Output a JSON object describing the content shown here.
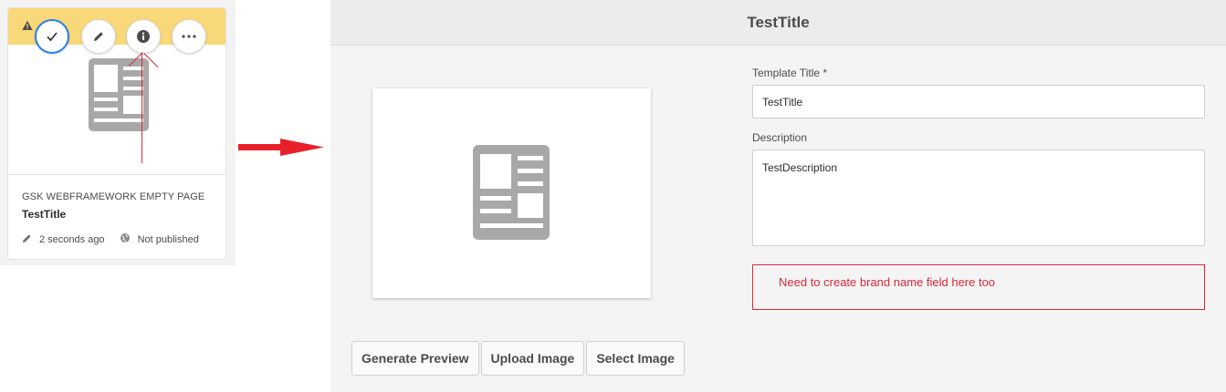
{
  "card": {
    "type_label": "GSK WEBFRAMEWORK EMPTY PAGE",
    "title": "TestTitle",
    "modified": "2 seconds ago",
    "publish_status": "Not published",
    "banner_color": "#f8d878",
    "icons": [
      "alert-icon",
      "checkmark-icon",
      "edit-icon",
      "info-icon",
      "more-icon",
      "page-template-icon",
      "pencil-icon",
      "globe-icon"
    ]
  },
  "properties": {
    "header_title": "TestTitle",
    "template_title_label": "Template Title *",
    "template_title_value": "TestTitle",
    "description_label": "Description",
    "description_value": "TestDescription",
    "buttons": {
      "generate_preview": "Generate Preview",
      "upload_image": "Upload Image",
      "select_image": "Select Image"
    }
  },
  "annotation": {
    "note": "Need to create brand name field here too",
    "color": "#d9283c"
  }
}
